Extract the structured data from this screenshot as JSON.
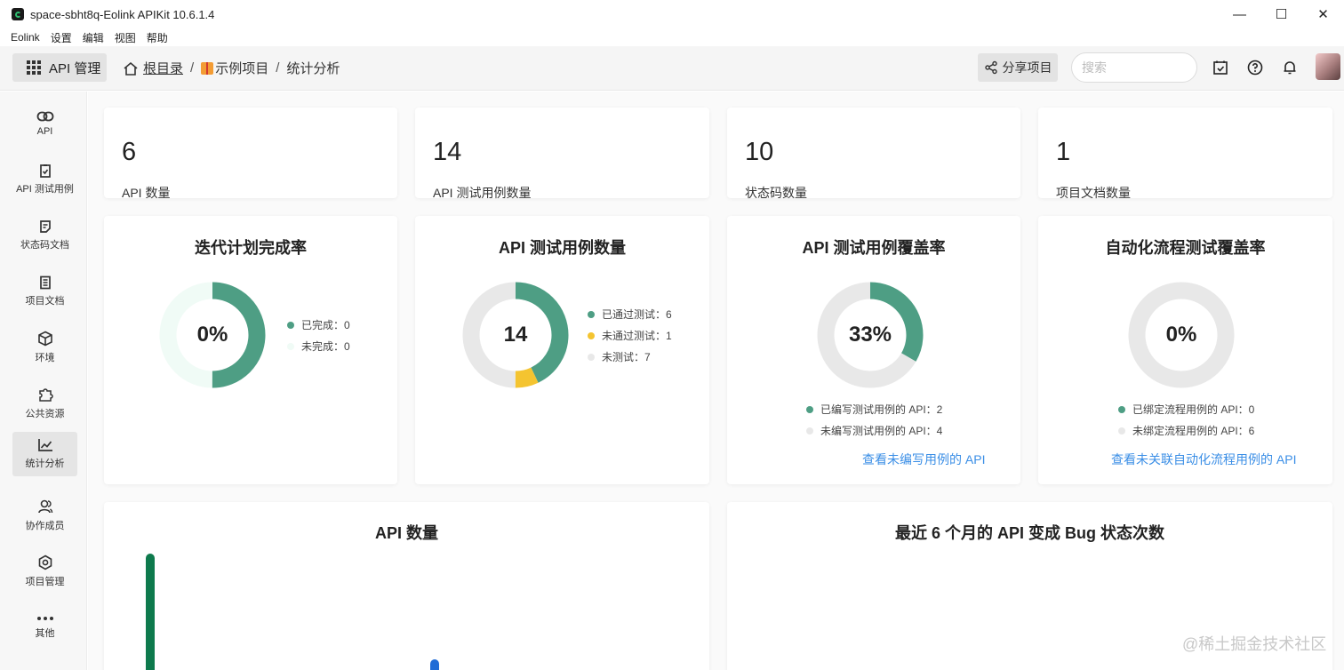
{
  "window": {
    "title": "space-sbht8q-Eolink APIKit 10.6.1.4",
    "controls": {
      "minimize": "—",
      "maximize": "☐",
      "close": "✕"
    }
  },
  "menu": [
    "Eolink",
    "设置",
    "编辑",
    "视图",
    "帮助"
  ],
  "toolbar": {
    "api_label": "API 管理",
    "breadcrumb": {
      "home": "根目录",
      "sep1": "/",
      "project": "示例项目",
      "sep2": "/",
      "page": "统计分析"
    },
    "share_label": "分享项目",
    "search_placeholder": "搜索",
    "icons": [
      "calendar-check-icon",
      "help-icon",
      "bell-icon"
    ]
  },
  "sidebar": {
    "items": [
      {
        "label": "API",
        "icon": "link-icon"
      },
      {
        "label": "API 测试用例",
        "icon": "clipboard-check-icon"
      },
      {
        "label": "状态码文档",
        "icon": "note-icon"
      },
      {
        "label": "项目文档",
        "icon": "document-icon"
      },
      {
        "label": "环境",
        "icon": "cube-icon"
      },
      {
        "label": "公共资源",
        "icon": "puzzle-icon"
      },
      {
        "label": "统计分析",
        "icon": "line-chart-icon",
        "active": true
      },
      {
        "label": "协作成员",
        "icon": "members-icon"
      },
      {
        "label": "项目管理",
        "icon": "settings-icon"
      },
      {
        "label": "其他",
        "icon": "more-icon"
      }
    ]
  },
  "stats": [
    {
      "value": "6",
      "label": "API 数量"
    },
    {
      "value": "14",
      "label": "API 测试用例数量"
    },
    {
      "value": "10",
      "label": "状态码数量"
    },
    {
      "value": "1",
      "label": "项目文档数量"
    }
  ],
  "charts": [
    {
      "title": "迭代计划完成率",
      "center": "0%",
      "legend": [
        "已完成：0",
        "未完成：0"
      ]
    },
    {
      "title": "API 测试用例数量",
      "center": "14",
      "legend": [
        "已通过测试：6",
        "未通过测试：1",
        "未测试：7"
      ]
    },
    {
      "title": "API 测试用例覆盖率",
      "center": "33%",
      "legend": [
        "已编写测试用例的 API：2",
        "未编写测试用例的 API：4"
      ],
      "link": "查看未编写用例的 API"
    },
    {
      "title": "自动化流程测试覆盖率",
      "center": "0%",
      "legend": [
        "已绑定流程用例的 API：0",
        "未绑定流程用例的 API：6"
      ],
      "link": "查看未关联自动化流程用例的 API"
    }
  ],
  "bottom": {
    "api_count_title": "API 数量",
    "bug_title": "最近 6 个月的 API 变成 Bug 状态次数"
  },
  "watermark": "@稀土掘金技术社区",
  "colors": {
    "green": "#4e9e84",
    "yellow": "#f4c430",
    "grey": "#e8e8e8",
    "pale": "#f0fbf6",
    "link": "#3a8ee6",
    "bar_green": "#0e7a4d",
    "bar_blue": "#1e6bd6"
  },
  "chart_data": [
    {
      "type": "pie",
      "title": "迭代计划完成率",
      "labels": [
        "已完成",
        "未完成"
      ],
      "values": [
        0,
        0
      ]
    },
    {
      "type": "pie",
      "title": "API 测试用例数量",
      "labels": [
        "已通过测试",
        "未通过测试",
        "未测试"
      ],
      "values": [
        6,
        1,
        7
      ]
    },
    {
      "type": "pie",
      "title": "API 测试用例覆盖率",
      "labels": [
        "已编写测试用例的 API",
        "未编写测试用例的 API"
      ],
      "values": [
        2,
        4
      ]
    },
    {
      "type": "pie",
      "title": "自动化流程测试覆盖率",
      "labels": [
        "已绑定流程用例的 API",
        "未绑定流程用例的 API"
      ],
      "values": [
        0,
        6
      ]
    }
  ]
}
